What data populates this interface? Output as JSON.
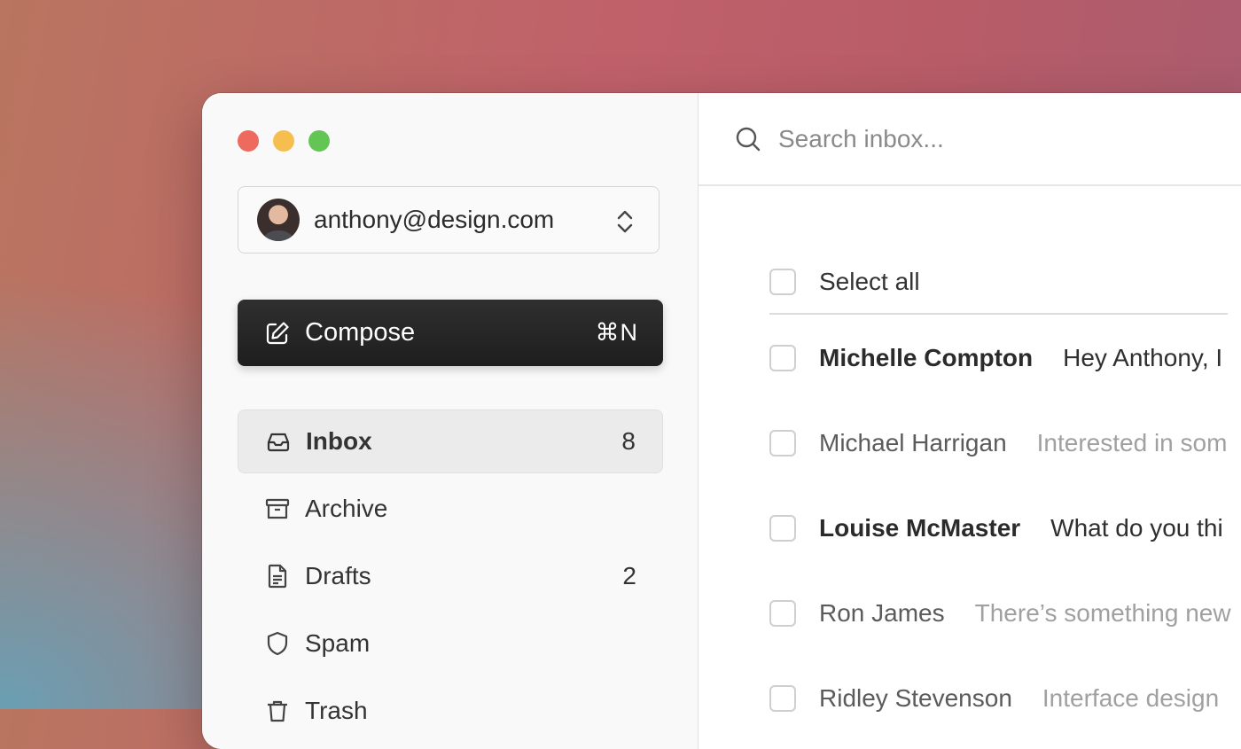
{
  "window": {
    "controls": [
      "close",
      "minimize",
      "zoom"
    ]
  },
  "account": {
    "email": "anthony@design.com",
    "avatar": "profile-photo",
    "switcher_icon": "chevron-up-down-icon"
  },
  "compose": {
    "label": "Compose",
    "shortcut": "⌘N",
    "icon": "pencil-square-icon"
  },
  "sidebar": {
    "items": [
      {
        "label": "Inbox",
        "count": "8",
        "icon": "inbox-icon",
        "active": true
      },
      {
        "label": "Archive",
        "count": "",
        "icon": "archive-box-icon",
        "active": false
      },
      {
        "label": "Drafts",
        "count": "2",
        "icon": "document-icon",
        "active": false
      },
      {
        "label": "Spam",
        "count": "",
        "icon": "shield-icon",
        "active": false
      },
      {
        "label": "Trash",
        "count": "",
        "icon": "trash-icon",
        "active": false
      }
    ]
  },
  "search": {
    "placeholder": "Search inbox...",
    "value": "",
    "icon": "search-icon"
  },
  "list": {
    "select_all_label": "Select all",
    "messages": [
      {
        "sender": "Michelle Compton",
        "preview": "Hey Anthony, I",
        "unread": true
      },
      {
        "sender": "Michael Harrigan",
        "preview": "Interested in som",
        "unread": false
      },
      {
        "sender": "Louise McMaster",
        "preview": "What do you thi",
        "unread": true
      },
      {
        "sender": "Ron James",
        "preview": "There’s something new",
        "unread": false
      },
      {
        "sender": "Ridley Stevenson",
        "preview": "Interface design",
        "unread": false
      }
    ]
  },
  "colors": {
    "accent_dark": "#1e1e1e",
    "close": "#ee6a5f",
    "minimize": "#f5be4f",
    "zoom": "#62c554"
  }
}
